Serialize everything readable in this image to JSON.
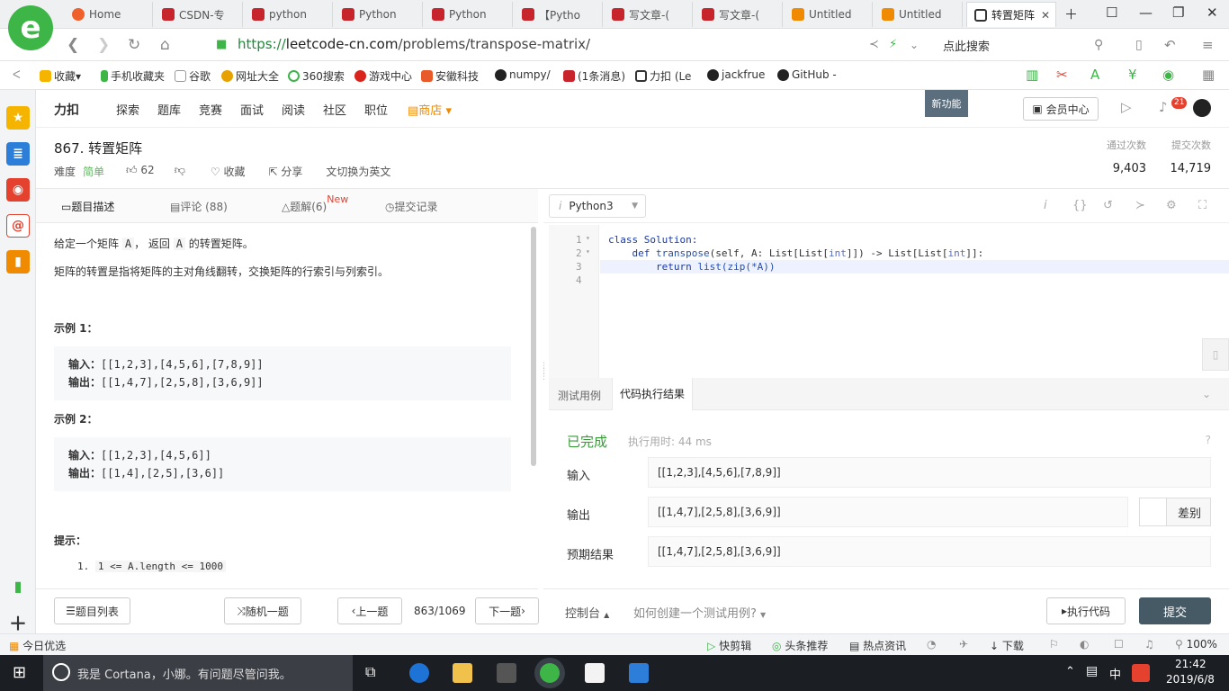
{
  "browser": {
    "tabs": [
      {
        "label": "Home",
        "color": "#f0602a"
      },
      {
        "label": "CSDN-专",
        "color": "#c8242b"
      },
      {
        "label": "python",
        "color": "#c8242b"
      },
      {
        "label": "Python",
        "color": "#c8242b"
      },
      {
        "label": "Python",
        "color": "#c8242b"
      },
      {
        "label": "【Pytho",
        "color": "#c8242b"
      },
      {
        "label": "写文章-(",
        "color": "#c8242b"
      },
      {
        "label": "写文章-(",
        "color": "#c8242b"
      },
      {
        "label": "Untitled",
        "color": "#f08a00"
      },
      {
        "label": "Untitled",
        "color": "#f08a00"
      },
      {
        "label": "转置矩阵",
        "color": "#333333"
      }
    ],
    "url_scheme": "https://",
    "url_host": "leetcode-cn.com",
    "url_path": "/problems/transpose-matrix/",
    "search_placeholder": "点此搜索",
    "bookmarks": [
      "收藏",
      "手机收藏夹",
      "谷歌",
      "网址大全",
      "360搜索",
      "游戏中心",
      "安徽科技",
      "numpy/",
      "(1条消息)",
      "力扣 (Le",
      "jackfrue",
      "GitHub -"
    ]
  },
  "lc": {
    "logo": "力扣",
    "nav": [
      "探索",
      "题库",
      "竞赛",
      "面试",
      "阅读",
      "社区",
      "职位"
    ],
    "store": "商店",
    "new_feature": "新功能",
    "vip": "会员中心",
    "notif_count": "21"
  },
  "problem": {
    "title": "867. 转置矩阵",
    "difficulty_label": "难度",
    "difficulty": "简单",
    "likes": "62",
    "favorite": "收藏",
    "share": "分享",
    "switch_lang": "切换为英文",
    "accepted_label": "通过次数",
    "accepted": "9,403",
    "submissions_label": "提交次数",
    "submissions": "14,719"
  },
  "left": {
    "tabs": [
      "题目描述",
      "评论 (88)",
      "题解(6)",
      "提交记录"
    ],
    "new_tag": "New",
    "desc1_a": "给定一个矩阵 ",
    "desc1_code1": "A",
    "desc1_b": "， 返回 ",
    "desc1_code2": "A",
    "desc1_c": " 的转置矩阵。",
    "desc2": "矩阵的转置是指将矩阵的主对角线翻转，交换矩阵的行索引与列索引。",
    "ex1_title": "示例 1：",
    "ex1_in_label": "输入：",
    "ex1_in": "[[1,2,3],[4,5,6],[7,8,9]]",
    "ex1_out_label": "输出：",
    "ex1_out": "[[1,4,7],[2,5,8],[3,6,9]]",
    "ex2_title": "示例 2：",
    "ex2_in_label": "输入：",
    "ex2_in": "[[1,2,3],[4,5,6]]",
    "ex2_out_label": "输出：",
    "ex2_out": "[[1,4],[2,5],[3,6]]",
    "hint_title": "提示：",
    "hint1_num": "1.",
    "hint1": "1 <= A.length <= 1000",
    "bottom": {
      "list": "题目列表",
      "random": "随机一题",
      "prev": "上一题",
      "page": "863/1069",
      "next": "下一题"
    }
  },
  "editor": {
    "language": "Python3",
    "line_numbers": [
      "1",
      "2",
      "3",
      "4"
    ],
    "line1": "class Solution:",
    "line2_a": "    def ",
    "line2_fn": "transpose",
    "line2_b": "(self, A: List[List[",
    "line2_int1": "int",
    "line2_c": "]]) -> List[List[",
    "line2_int2": "int",
    "line2_d": "]]:",
    "line3_a": "        return ",
    "line3_b": "list(zip(*A))"
  },
  "console": {
    "tabs": [
      "测试用例",
      "代码执行结果"
    ],
    "status": "已完成",
    "time": "执行用时: 44 ms",
    "input_label": "输入",
    "input": "[[1,2,3],[4,5,6],[7,8,9]]",
    "output_label": "输出",
    "output": "[[1,4,7],[2,5,8],[3,6,9]]",
    "diff": "差别",
    "expected_label": "预期结果",
    "expected": "[[1,4,7],[2,5,8],[3,6,9]]",
    "bottom": {
      "console": "控制台",
      "howto": "如何创建一个测试用例?",
      "run": "执行代码",
      "submit": "提交"
    }
  },
  "statusbar": {
    "left": "今日优选",
    "items": [
      "快剪辑",
      "头条推荐",
      "热点资讯",
      "下载"
    ],
    "zoom": "100%"
  },
  "taskbar": {
    "cortana": "我是 Cortana，小娜。有问题尽管问我。",
    "time": "21:42",
    "date": "2019/6/8",
    "ime": "中"
  }
}
